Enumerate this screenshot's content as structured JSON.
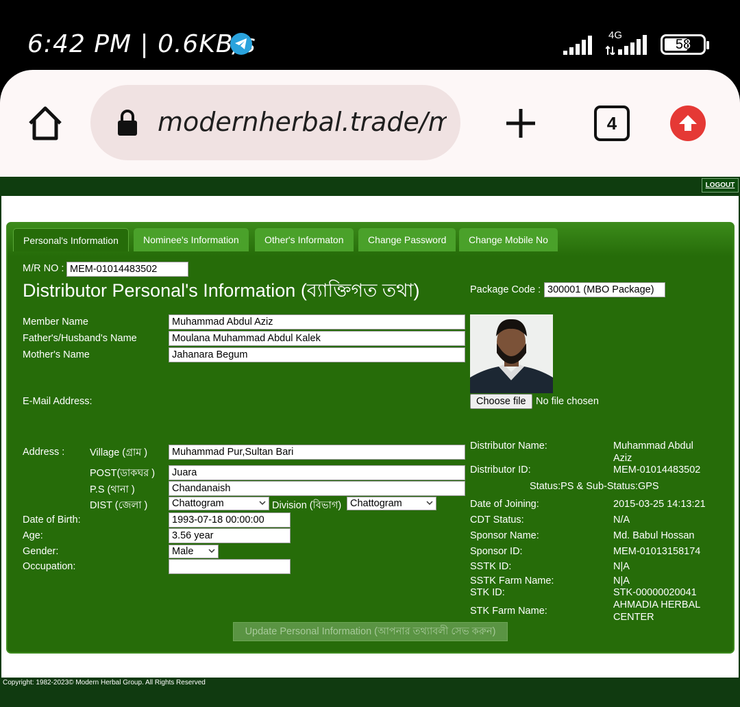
{
  "status_bar": {
    "time_speed": "6:42 PM | 0.6KB/s",
    "network": "4G",
    "battery": "58",
    "telegram_icon": "telegram-icon"
  },
  "browser": {
    "url": "modernherbal.trade/mx",
    "tab_count": "4"
  },
  "header": {
    "logout": "LOGOUT"
  },
  "tabs": [
    {
      "label": "Personal's Information"
    },
    {
      "label": "Nominee's Information"
    },
    {
      "label": "Other's Informaton"
    },
    {
      "label": "Change Password"
    },
    {
      "label": "Change Mobile No"
    }
  ],
  "form": {
    "mr_no_label": "M/R NO :",
    "mr_no": "MEM-01014483502",
    "title": "Distributor Personal's Information (ব্যাক্তিগত তথা)",
    "package_code_label": "Package Code :",
    "package_code": "300001 (MBO Package)",
    "member_name_label": "Member Name",
    "member_name": "Muhammad Abdul Aziz",
    "father_label": "Father's/Husband's Name",
    "father": "Moulana Muhammad Abdul Kalek",
    "mother_label": "Mother's Name",
    "mother": "Jahanara Begum",
    "email_label": "E-Mail Address:",
    "choose_file": "Choose file",
    "no_file": "No file chosen",
    "address_label": "Address :",
    "village_label": "Village (গ্রাম )",
    "village": "Muhammad Pur,Sultan Bari",
    "post_label": "POST(ডাকঘর )",
    "post": "Juara",
    "ps_label": "P.S (থানা )",
    "ps": "Chandanaish",
    "dist_label": "DIST (জেলা )",
    "dist": "Chattogram",
    "division_label": "Division (বিভাগ)",
    "division": "Chattogram",
    "dob_label": "Date of Birth:",
    "dob": "1993-07-18 00:00:00",
    "age_label": "Age:",
    "age": "3.56 year",
    "gender_label": "Gender:",
    "gender": "Male",
    "occupation_label": "Occupation:",
    "occupation": "",
    "update_button": "Update Personal Information (আপনার তথ্যাবলী সেভ করুন)"
  },
  "distributor": {
    "name_label": "Distributor Name:",
    "name_line1": "Muhammad Abdul",
    "name_line2": "Aziz",
    "id_label": "Distributor ID:",
    "id": "MEM-01014483502",
    "status": "Status:PS & Sub-Status:GPS",
    "doj_label": "Date of Joining:",
    "doj": "2015-03-25 14:13:21",
    "cdt_label": "CDT Status:",
    "cdt": "N/A",
    "sponsor_name_label": "Sponsor Name:",
    "sponsor_name": "Md. Babul Hossan",
    "sponsor_id_label": "Sponsor ID:",
    "sponsor_id": "MEM-01013158174",
    "sstk_id_label": "SSTK ID:",
    "sstk_id": "N|A",
    "sstk_farm_label": "SSTK Farm Name:",
    "sstk_farm": "N|A",
    "stk_id_label": "STK ID:",
    "stk_id": "STK-00000020041",
    "stk_farm_label": "STK Farm Name:",
    "stk_farm_line1": "AHMADIA HERBAL",
    "stk_farm_line2": "CENTER"
  },
  "footer": {
    "copyright": "Copyright: 1982-2023© Modern Herbal Group. All Rights Reserved"
  }
}
